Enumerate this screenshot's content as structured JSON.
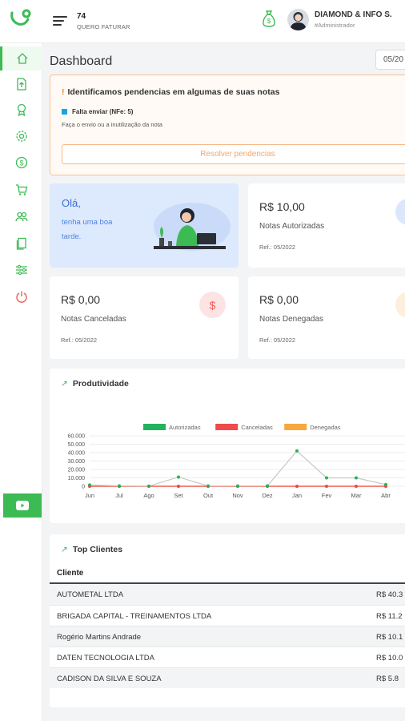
{
  "header": {
    "company_number": "74",
    "company_name": "QUERO FATURAR",
    "user_name": "DIAMOND & INFO S.",
    "user_role": "#Administrador"
  },
  "sidebar": {
    "items": [
      {
        "icon": "home-icon",
        "active": true
      },
      {
        "icon": "invoice-upload-icon"
      },
      {
        "icon": "award-icon"
      },
      {
        "icon": "settings-icon"
      },
      {
        "icon": "dollar-icon"
      },
      {
        "icon": "cart-icon"
      },
      {
        "icon": "users-icon"
      },
      {
        "icon": "documents-icon"
      },
      {
        "icon": "sliders-icon"
      },
      {
        "icon": "power-icon"
      }
    ],
    "youtube_icon": "youtube-icon"
  },
  "main": {
    "title": "Dashboard",
    "date_filter": "05/20"
  },
  "alert": {
    "title": "Identificamos pendencias em algumas de suas notas",
    "item": "Falta enviar (NFe: 5)",
    "subtitle": "Faça o envio ou a inutilização da nota",
    "button": "Resolver pendencias"
  },
  "welcome": {
    "greeting": "Olá,",
    "message": "tenha uma boa tarde."
  },
  "stats": [
    {
      "value": "R$ 10,00",
      "label": "Notas Autorizadas",
      "ref": "Ref.: 05/2022",
      "badge_color": "#dbe7fb"
    },
    {
      "value": "R$ 0,00",
      "label": "Notas Canceladas",
      "ref": "Ref.: 05/2022",
      "badge_color": "#fde3e3",
      "badge_symbol": "$"
    },
    {
      "value": "R$ 0,00",
      "label": "Notas Denegadas",
      "ref": "Ref.: 05/2022",
      "badge_color": "#fdeedd"
    }
  ],
  "productivity": {
    "title": "Produtividade"
  },
  "chart_data": {
    "type": "line",
    "categories": [
      "Jun",
      "Jul",
      "Ago",
      "Set",
      "Out",
      "Nov",
      "Dez",
      "Jan",
      "Fev",
      "Mar",
      "Abr"
    ],
    "series": [
      {
        "name": "Autorizadas",
        "color": "#22b35e",
        "values": [
          1500,
          500,
          200,
          11000,
          300,
          400,
          500,
          42000,
          10000,
          10000,
          2000
        ]
      },
      {
        "name": "Canceladas",
        "color": "#f04a4a",
        "values": [
          0,
          0,
          0,
          0,
          0,
          0,
          0,
          0,
          0,
          0,
          0
        ]
      },
      {
        "name": "Denegadas",
        "color": "#f7a83e",
        "values": [
          0,
          0,
          0,
          0,
          0,
          0,
          0,
          0,
          0,
          0,
          0
        ]
      }
    ],
    "yticks": [
      "0",
      "10.000",
      "20.000",
      "30.000",
      "40.000",
      "50.000",
      "60.000"
    ],
    "ylim": [
      0,
      60000
    ],
    "legend": "top-center",
    "grid": true
  },
  "top_clients": {
    "title": "Top Clientes",
    "column": "Cliente",
    "rows": [
      {
        "name": "AUTOMETAL LTDA",
        "amount": "R$ 40.3"
      },
      {
        "name": "BRIGADA CAPITAL - TREINAMENTOS LTDA",
        "amount": "R$ 11.2"
      },
      {
        "name": "Rogério Martins Andrade",
        "amount": "R$ 10.1"
      },
      {
        "name": "DATEN TECNOLOGIA LTDA",
        "amount": "R$ 10.0"
      },
      {
        "name": "CADISON DA SILVA E SOUZA",
        "amount": "R$ 5.8"
      }
    ]
  }
}
